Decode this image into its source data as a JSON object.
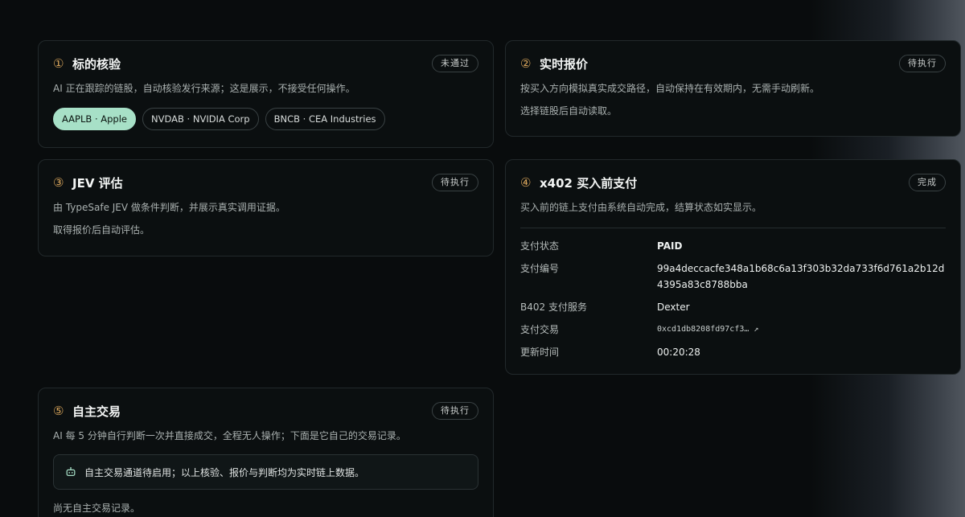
{
  "cards": [
    {
      "num": "①",
      "title": "标的核验",
      "status": "未通过",
      "desc": "AI 正在跟踪的链股，自动核验发行来源；这是展示，不接受任何操作。",
      "chips": [
        "AAPLB · Apple",
        "NVDAB · NVIDIA Corp",
        "BNCB · CEA Industries"
      ]
    },
    {
      "num": "②",
      "title": "实时报价",
      "status": "待执行",
      "desc": "按买入方向模拟真实成交路径，自动保持在有效期内，无需手动刷新。",
      "desc2": "选择链股后自动读取。"
    },
    {
      "num": "③",
      "title": "JEV 评估",
      "status": "待执行",
      "desc": "由 TypeSafe JEV 做条件判断，并展示真实调用证据。",
      "desc2": "取得报价后自动评估。"
    },
    {
      "num": "④",
      "title": "x402 买入前支付",
      "status": "完成",
      "desc": "买入前的链上支付由系统自动完成，结算状态如实显示。",
      "rows": [
        {
          "k": "支付状态",
          "v": "PAID"
        },
        {
          "k": "支付编号",
          "v": "99a4deccacfe348a1b68c6a13f303b32da733f6d761a2b12d4395a83c8788bba"
        },
        {
          "k": "B402 支付服务",
          "v": "Dexter"
        },
        {
          "k": "支付交易",
          "v": "0xcd1db8208fd97cf3…"
        },
        {
          "k": "更新时间",
          "v": "00:20:28"
        }
      ]
    },
    {
      "num": "⑤",
      "title": "自主交易",
      "status": "待执行",
      "desc": "AI 每 5 分钟自行判断一次并直接成交，全程无人操作；下面是它自己的交易记录。",
      "notice": "自主交易通道待启用；以上核验、报价与判断均为实时链上数据。",
      "empty": "尚无自主交易记录。"
    }
  ],
  "icons": {
    "external": "↗",
    "robot": "robot-icon"
  },
  "colors": {
    "accent": "#a7e0c7",
    "step_number": "#d6a35a"
  }
}
